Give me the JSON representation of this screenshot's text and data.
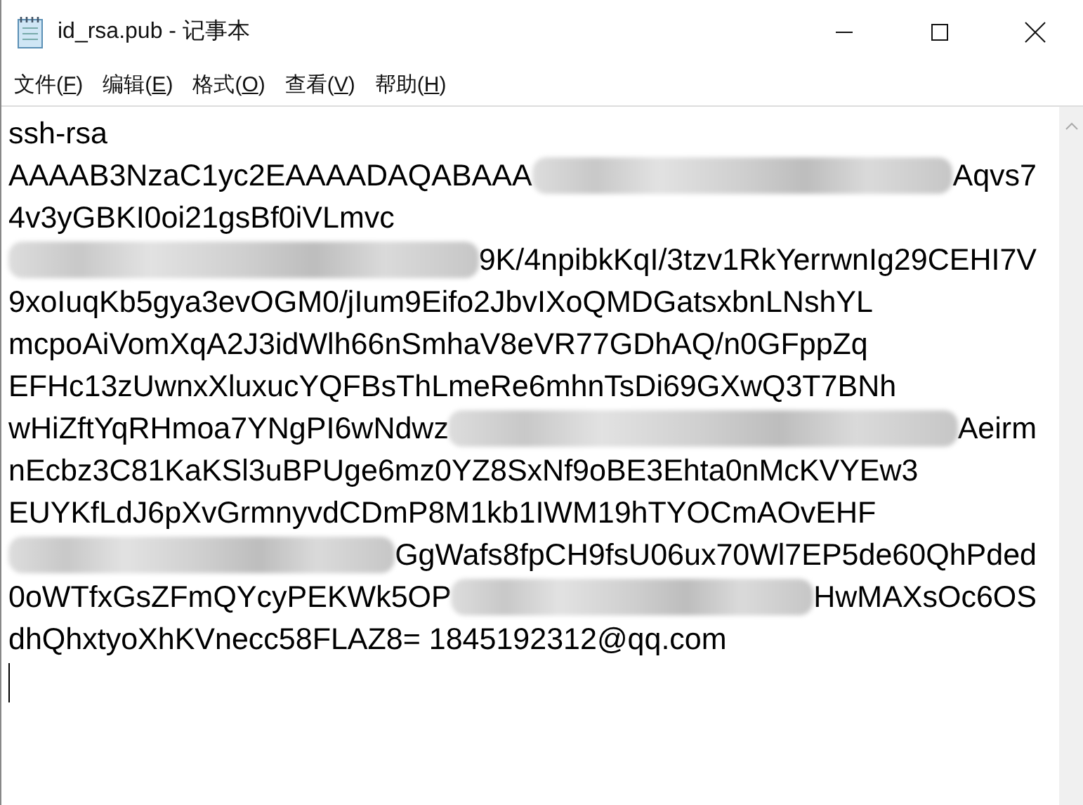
{
  "window": {
    "title": "id_rsa.pub - 记事本"
  },
  "menu": [
    {
      "label": "文件(F)"
    },
    {
      "label": "编辑(E)"
    },
    {
      "label": "格式(O)"
    },
    {
      "label": "查看(V)"
    },
    {
      "label": "帮助(H)"
    }
  ],
  "editor": {
    "caret_visible": true,
    "lines": [
      [
        {
          "kind": "text",
          "text": "ssh-rsa"
        }
      ],
      [
        {
          "kind": "text",
          "text": "AAAAB3NzaC1yc2EAAAADAQABAAA"
        },
        {
          "kind": "redacted"
        },
        {
          "kind": "text",
          "text": "Aqvs7"
        }
      ],
      [
        {
          "kind": "text",
          "text": "4v3yGBKI0oi21gsBf0iVLmvc"
        }
      ],
      [
        {
          "kind": "redacted"
        },
        {
          "kind": "text",
          "text": "9K/4npibkKqI/3tzv1RkYerrwnIg29CEHI7V"
        }
      ],
      [
        {
          "kind": "text",
          "text": "9xoIuqKb5gya3evOGM0/jIum9Eifo2JbvIXoQMDGatsxbnLNshYL"
        }
      ],
      [
        {
          "kind": "text",
          "text": "mcpoAiVomXqA2J3idWlh66nSmhaV8eVR77GDhAQ/n0GFppZq"
        }
      ],
      [
        {
          "kind": "text",
          "text": "EFHc13zUwnxXluxucYQFBsThLmeRe6mhnTsDi69GXwQ3T7BNh"
        }
      ],
      [
        {
          "kind": "text",
          "text": "wHiZftYqRHmoa7YNgPI6wNdwz"
        },
        {
          "kind": "redacted"
        },
        {
          "kind": "text",
          "text": "Aeirm"
        }
      ],
      [
        {
          "kind": "text",
          "text": "nEcbz3C81KaKSl3uBPUge6mz0YZ8SxNf9oBE3Ehta0nMcKVYEw3"
        }
      ],
      [
        {
          "kind": "text",
          "text": "EUYKfLdJ6pXvGrmnyvdCDmP8M1kb1IWM19hTYOCmAOvEHF"
        }
      ],
      [
        {
          "kind": "redacted"
        },
        {
          "kind": "text",
          "text": "GgWafs8fpCH9fsU06ux70Wl7EP5de60QhPded"
        }
      ],
      [
        {
          "kind": "text",
          "text": "0oWTfxGsZFmQYcyPEKWk5OP"
        },
        {
          "kind": "redacted"
        },
        {
          "kind": "text",
          "text": "HwMAXsOc6OS"
        }
      ],
      [
        {
          "kind": "text",
          "text": "dhQhxtyoXhKVnecc58FLAZ8= 1845192312@qq.com"
        }
      ]
    ]
  }
}
